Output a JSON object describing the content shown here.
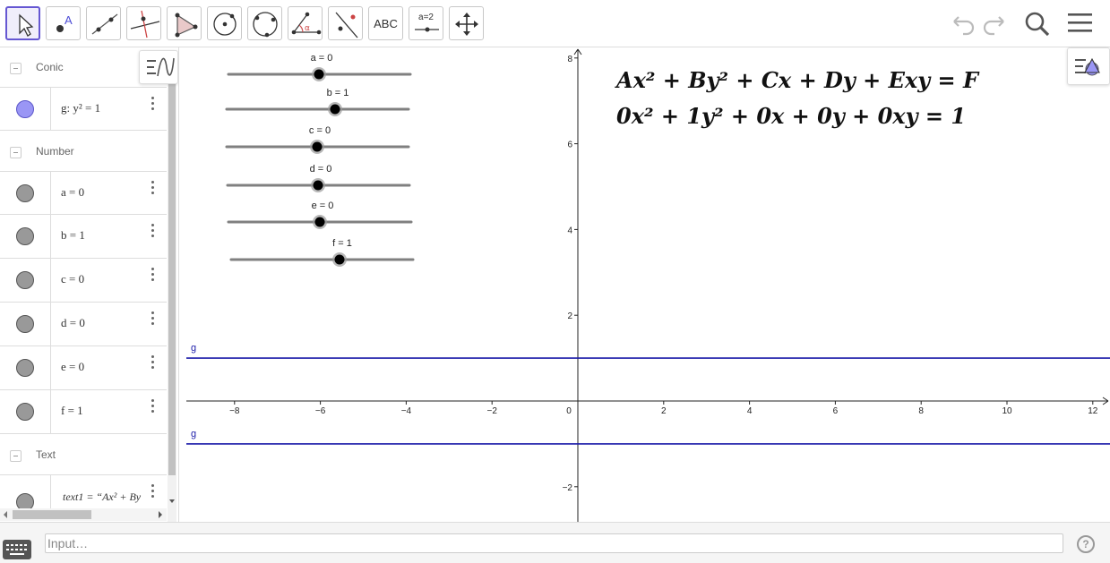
{
  "toolbar": {
    "tools": [
      {
        "name": "move-tool",
        "label": ""
      },
      {
        "name": "point-tool",
        "label": ""
      },
      {
        "name": "line-tool",
        "label": ""
      },
      {
        "name": "perpendicular-line-tool",
        "label": ""
      },
      {
        "name": "polygon-tool",
        "label": ""
      },
      {
        "name": "circle-center-point-tool",
        "label": ""
      },
      {
        "name": "circle-three-points-tool",
        "label": ""
      },
      {
        "name": "angle-tool",
        "label": ""
      },
      {
        "name": "reflect-tool",
        "label": ""
      },
      {
        "name": "text-tool",
        "label": "ABC"
      },
      {
        "name": "slider-tool",
        "label": "a=2"
      },
      {
        "name": "move-graphics-view-tool",
        "label": ""
      }
    ],
    "accent_color": "#6557d2"
  },
  "algebra": {
    "groups": [
      {
        "name": "conic",
        "label": "Conic"
      },
      {
        "name": "number",
        "label": "Number"
      },
      {
        "name": "text",
        "label": "Text"
      }
    ],
    "items": [
      {
        "id": "g",
        "text": "g: y² = 1",
        "type": "conic"
      },
      {
        "id": "a",
        "text": "a = 0",
        "type": "number"
      },
      {
        "id": "b",
        "text": "b = 1",
        "type": "number"
      },
      {
        "id": "c",
        "text": "c = 0",
        "type": "number"
      },
      {
        "id": "d",
        "text": "d = 0",
        "type": "number"
      },
      {
        "id": "e",
        "text": "e = 0",
        "type": "number"
      },
      {
        "id": "f",
        "text": "f = 1",
        "type": "number"
      },
      {
        "id": "text1",
        "text": "text1 = “Ax² + By",
        "type": "text"
      }
    ]
  },
  "graphics": {
    "sliders": [
      {
        "label": "a = 0",
        "value": 0
      },
      {
        "label": "b = 1",
        "value": 1
      },
      {
        "label": "c = 0",
        "value": 0
      },
      {
        "label": "d = 0",
        "value": 0
      },
      {
        "label": "e = 0",
        "value": 0
      },
      {
        "label": "f = 1",
        "value": 1
      }
    ],
    "equation_general": "Ax² + By² + Cx + Dy + Exy = F",
    "equation_values": "0x² + 1y² + 0x + 0y + 0xy = 1",
    "x_ticks": [
      "−8",
      "−6",
      "−4",
      "−2",
      "0",
      "2",
      "4",
      "6",
      "8",
      "10",
      "12"
    ],
    "y_ticks": [
      "8",
      "6",
      "4",
      "2",
      "−2"
    ],
    "curve_label_top": "g",
    "curve_label_bottom": "g",
    "curve_color": "#1a1aa8"
  },
  "input": {
    "placeholder": "Input…"
  },
  "help": {
    "label": "?"
  }
}
